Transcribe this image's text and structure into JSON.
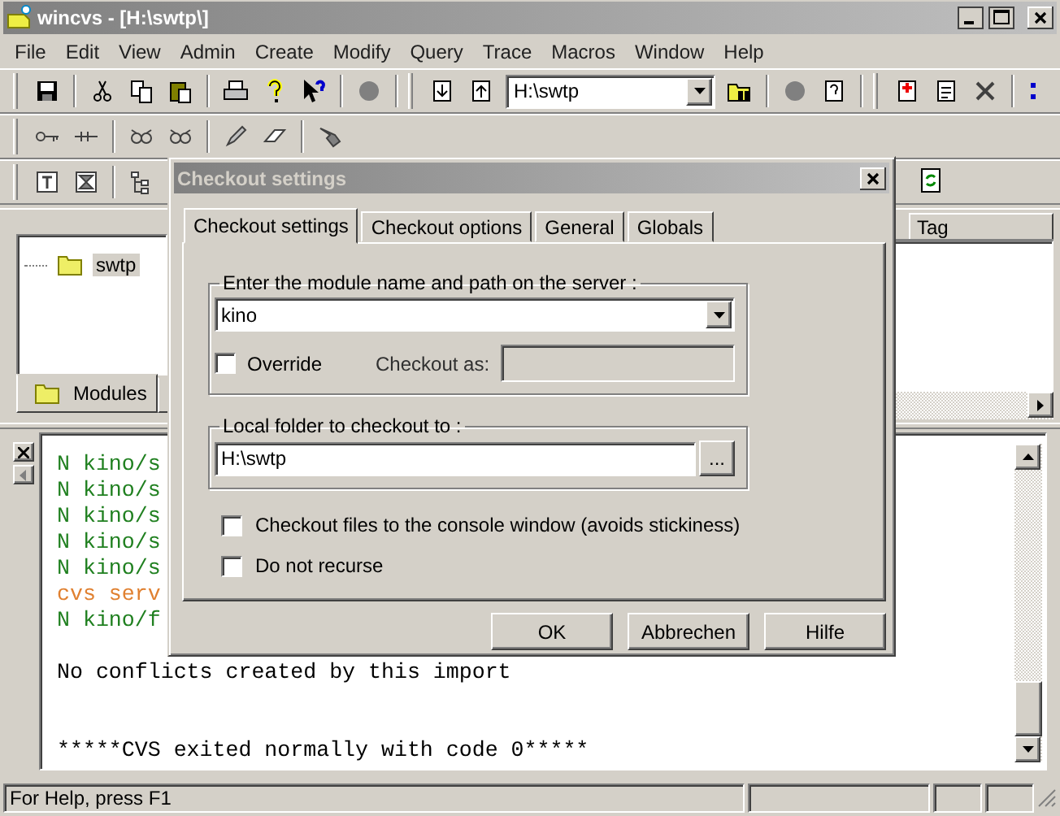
{
  "window": {
    "title": "wincvs - [H:\\swtp\\]"
  },
  "menu": [
    "File",
    "Edit",
    "View",
    "Admin",
    "Create",
    "Modify",
    "Query",
    "Trace",
    "Macros",
    "Window",
    "Help"
  ],
  "toolbar": {
    "path_combo": {
      "value": "H:\\swtp"
    }
  },
  "tree_panel": {
    "items": [
      {
        "label": "swtp",
        "selected": true
      }
    ],
    "tabs": [
      {
        "label": "Modules",
        "selected": true
      },
      {
        "selected": false
      }
    ]
  },
  "file_list": {
    "columns": [
      "Tag"
    ]
  },
  "console": {
    "lines": [
      {
        "kind": "new",
        "text": "N kino/s"
      },
      {
        "kind": "new",
        "text": "N kino/s"
      },
      {
        "kind": "new",
        "text": "N kino/s"
      },
      {
        "kind": "new",
        "text": "N kino/s"
      },
      {
        "kind": "new",
        "text": "N kino/s"
      },
      {
        "kind": "server",
        "text": "cvs serv"
      },
      {
        "kind": "new",
        "text": "N kino/f"
      },
      {
        "kind": "summary",
        "text": "No conflicts created by this import"
      },
      {
        "kind": "exit",
        "text": "*****CVS exited normally with code 0*****"
      }
    ]
  },
  "status_bar": {
    "text": "For Help, press F1"
  },
  "dialog": {
    "title": "Checkout settings",
    "tabs": [
      {
        "label": "Checkout settings",
        "selected": true
      },
      {
        "label": "Checkout options",
        "selected": false
      },
      {
        "label": "General",
        "selected": false
      },
      {
        "label": "Globals",
        "selected": false
      }
    ],
    "module_group": {
      "label": "Enter the module name and path on the server :",
      "module_combo": {
        "value": "kino"
      },
      "override": {
        "label": "Override",
        "checked": false
      },
      "checkout_as": {
        "label": "Checkout as:",
        "disabled": true
      }
    },
    "folder_group": {
      "label": "Local folder to checkout to :",
      "folder_field": {
        "value": "H:\\swtp"
      },
      "browse_button": "..."
    },
    "options": [
      {
        "label": "Checkout files to the console window (avoids stickiness)",
        "checked": false
      },
      {
        "label": "Do not recurse",
        "checked": false
      }
    ],
    "buttons": [
      "OK",
      "Abbrechen",
      "Hilfe"
    ]
  }
}
